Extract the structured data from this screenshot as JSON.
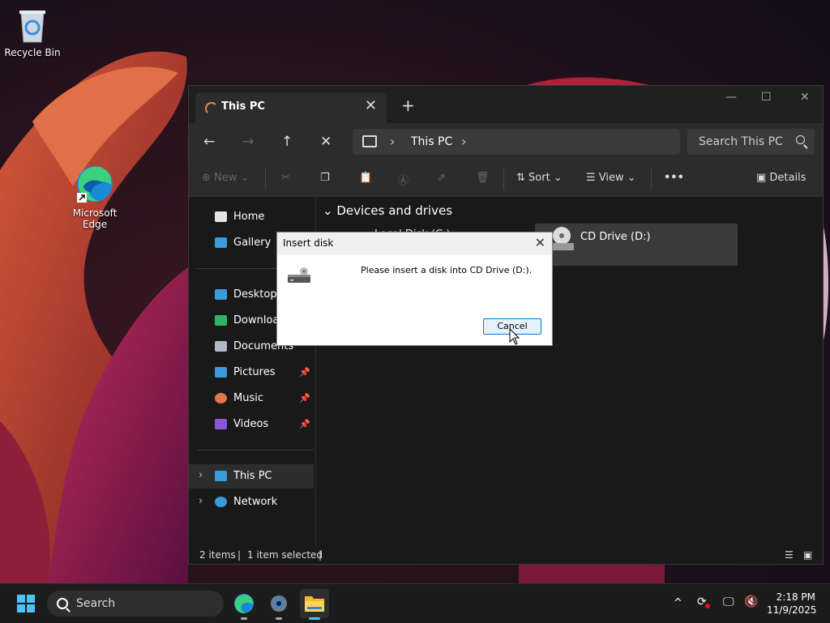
{
  "desktop": {
    "icons": [
      {
        "label": "Recycle Bin",
        "icon": "recycle-bin-icon"
      },
      {
        "label": "Microsoft Edge",
        "icon": "edge-icon"
      }
    ]
  },
  "explorer": {
    "tab_title": "This PC",
    "tab_close": "✕",
    "new_tab": "+",
    "window_controls": {
      "minimize": "—",
      "maximize": "☐",
      "close": "✕"
    },
    "nav": {
      "back": "←",
      "forward": "→",
      "up": "↑",
      "stop": "✕"
    },
    "address": {
      "chevron": "›",
      "crumb": "This PC"
    },
    "search": {
      "placeholder": "Search This PC"
    },
    "toolbar": {
      "new": "New",
      "sort": "Sort",
      "view": "View",
      "more": "•••",
      "details": "Details"
    },
    "sidebar": {
      "items": [
        {
          "label": "Home",
          "icon": "home-icon",
          "color": "#e5e5e5"
        },
        {
          "label": "Gallery",
          "icon": "gallery-icon",
          "color": "#3a9bdc"
        },
        {
          "label": "Desktop",
          "icon": "desktop-icon",
          "color": "#3a9bdc"
        },
        {
          "label": "Downloads",
          "icon": "download-icon",
          "color": "#2fb36a"
        },
        {
          "label": "Documents",
          "icon": "documents-icon",
          "color": "#b0b8c4"
        },
        {
          "label": "Pictures",
          "icon": "pictures-icon",
          "color": "#3a9bdc"
        },
        {
          "label": "Music",
          "icon": "music-icon",
          "color": "#e0764a"
        },
        {
          "label": "Videos",
          "icon": "videos-icon",
          "color": "#8a58d6"
        },
        {
          "label": "This PC",
          "icon": "this-pc-icon",
          "color": "#3a9bdc"
        },
        {
          "label": "Network",
          "icon": "network-icon",
          "color": "#3a9bdc"
        }
      ],
      "pin": "📌",
      "expand": "›"
    },
    "content": {
      "group_label": "Devices and drives",
      "group_chevron": "⌄",
      "local_disk": "Local Disk (C:)",
      "cd_drive": "CD Drive (D:)"
    },
    "status": {
      "items": "2 items",
      "selected": "1 item selected",
      "sep": "|"
    }
  },
  "dialog": {
    "title": "Insert disk",
    "close": "✕",
    "message": "Please insert a disk into CD Drive (D:).",
    "cancel": "Cancel"
  },
  "taskbar": {
    "search_placeholder": "Search",
    "apps": [
      "edge-icon",
      "settings-icon",
      "file-explorer-icon"
    ],
    "tray": {
      "chevron": "^"
    },
    "time": "2:18 PM",
    "date": "11/9/2025"
  }
}
